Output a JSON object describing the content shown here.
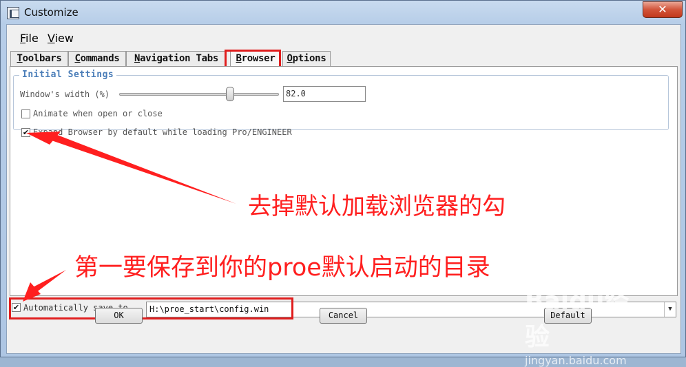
{
  "window": {
    "title": "Customize",
    "close_label": "✕"
  },
  "menu": {
    "file": "File",
    "view": "View"
  },
  "tabs": [
    "Toolbars",
    "Commands",
    "Navigation Tabs",
    "Browser",
    "Options"
  ],
  "initial_settings": {
    "legend": "Initial Settings",
    "width_label": "Window's width (%)",
    "width_value": "82.0",
    "slider_fraction": 0.82,
    "animate_label": "Animate when open or close",
    "animate_checked": false,
    "expand_label": "Expand Browser by default while loading Pro/ENGINEER",
    "expand_checked": true
  },
  "annotations": {
    "uncheck_note": "去掉默认加载浏览器的勾",
    "save_note": "第一要保存到你的proe默认启动的目录"
  },
  "autosave": {
    "label": "Automatically save to",
    "checked": true,
    "path": "H:\\proe_start\\config.win"
  },
  "buttons": {
    "ok": "OK",
    "cancel": "Cancel",
    "default": "Default"
  },
  "watermark": {
    "brand": "Baidu经验",
    "url": "jingyan.baidu.com"
  },
  "colors": {
    "annotation_red": "#ff1f1f",
    "legend_blue": "#4a7db8"
  }
}
